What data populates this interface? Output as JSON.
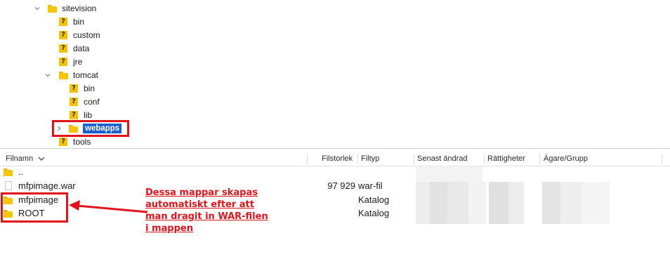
{
  "tree": {
    "items": [
      {
        "label": "sitevision",
        "kind": "folder",
        "expanded": true
      },
      {
        "label": "bin",
        "kind": "unknown"
      },
      {
        "label": "custom",
        "kind": "unknown"
      },
      {
        "label": "data",
        "kind": "unknown"
      },
      {
        "label": "jre",
        "kind": "unknown"
      },
      {
        "label": "tomcat",
        "kind": "folder",
        "expanded": true
      },
      {
        "label": "bin",
        "kind": "unknown"
      },
      {
        "label": "conf",
        "kind": "unknown"
      },
      {
        "label": "lib",
        "kind": "unknown"
      },
      {
        "label": "webapps",
        "kind": "folder",
        "selected": true,
        "expanded": false
      },
      {
        "label": "tools",
        "kind": "unknown"
      }
    ],
    "unknown_glyph": "?"
  },
  "list": {
    "columns": {
      "name": "Filnamn",
      "size": "Filstorlek",
      "type": "Filtyp",
      "modified": "Senast ändrad",
      "permissions": "Rättigheter",
      "owner": "Ägare/Grupp"
    },
    "rows": [
      {
        "name": "..",
        "size": "",
        "type": "",
        "icon": "folder-icon"
      },
      {
        "name": "mfpimage.war",
        "size": "97 929",
        "type": "war-fil",
        "icon": "file-icon"
      },
      {
        "name": "mfpimage",
        "size": "",
        "type": "Katalog",
        "icon": "folder-icon"
      },
      {
        "name": "ROOT",
        "size": "",
        "type": "Katalog",
        "icon": "folder-icon"
      }
    ]
  },
  "annotation": {
    "lines": [
      "Dessa mappar skapas",
      "automatiskt efter att",
      "man dragit in WAR-filen",
      "i mappen"
    ]
  },
  "colors": {
    "highlight_red": "#e3131b",
    "selection_blue": "#1a5fd0",
    "folder_yellow": "#f7c600"
  }
}
